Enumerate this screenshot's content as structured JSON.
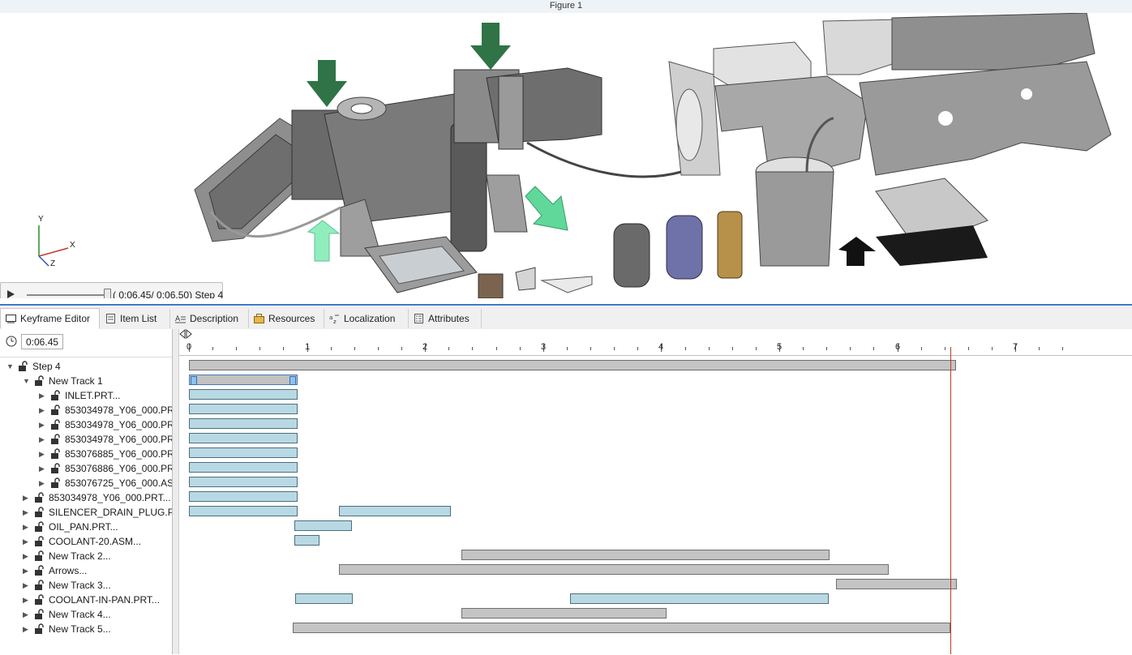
{
  "window": {
    "title": "Figure 1"
  },
  "axis_triad": {
    "y": "Y",
    "x": "X",
    "z": "Z"
  },
  "player": {
    "readout": "( 0:06.45/ 0:06.50)",
    "step": "Step 4",
    "progress": 0.992
  },
  "tabs": [
    {
      "label": "Keyframe Editor",
      "icon": "keyframe-editor-icon",
      "active": true
    },
    {
      "label": "Item List",
      "icon": "item-list-icon",
      "active": false
    },
    {
      "label": "Description",
      "icon": "description-icon",
      "active": false
    },
    {
      "label": "Resources",
      "icon": "resources-icon",
      "active": false
    },
    {
      "label": "Localization",
      "icon": "localization-icon",
      "active": false
    },
    {
      "label": "Attributes",
      "icon": "attributes-icon",
      "active": false
    }
  ],
  "time_field": {
    "value": "0:06.45"
  },
  "tree": [
    {
      "label": "Step 4",
      "level": 0,
      "expanded": true
    },
    {
      "label": "New Track 1",
      "level": 1,
      "expanded": true
    },
    {
      "label": "INLET.PRT...",
      "level": 2,
      "expanded": false
    },
    {
      "label": "853034978_Y06_000.PRT...",
      "level": 2,
      "expanded": false
    },
    {
      "label": "853034978_Y06_000.PRT...",
      "level": 2,
      "expanded": false
    },
    {
      "label": "853034978_Y06_000.PRT...",
      "level": 2,
      "expanded": false
    },
    {
      "label": "853076885_Y06_000.PRT...",
      "level": 2,
      "expanded": false
    },
    {
      "label": "853076886_Y06_000.PRT...",
      "level": 2,
      "expanded": false
    },
    {
      "label": "853076725_Y06_000.ASM...",
      "level": 2,
      "expanded": false
    },
    {
      "label": "853034978_Y06_000.PRT...",
      "level": 1,
      "expanded": false
    },
    {
      "label": "SILENCER_DRAIN_PLUG.PRT...",
      "level": 1,
      "expanded": false
    },
    {
      "label": "OIL_PAN.PRT...",
      "level": 1,
      "expanded": false
    },
    {
      "label": "COOLANT-20.ASM...",
      "level": 1,
      "expanded": false
    },
    {
      "label": "New Track 2...",
      "level": 1,
      "expanded": false
    },
    {
      "label": "Arrows...",
      "level": 1,
      "expanded": false
    },
    {
      "label": "New Track 3...",
      "level": 1,
      "expanded": false
    },
    {
      "label": "COOLANT-IN-PAN.PRT...",
      "level": 1,
      "expanded": false
    },
    {
      "label": "New Track 4...",
      "level": 1,
      "expanded": false
    },
    {
      "label": "New Track 5...",
      "level": 1,
      "expanded": false
    }
  ],
  "timeline": {
    "tick_labels": [
      "0",
      "1",
      "2",
      "3",
      "4",
      "5",
      "6",
      "7"
    ],
    "current_time": 6.45,
    "rows": [
      [
        {
          "start": 0.0,
          "end": 6.5,
          "color": "gray"
        }
      ],
      [
        {
          "start": 0.0,
          "end": 0.92,
          "color": "gray",
          "selected": true
        }
      ],
      [
        {
          "start": 0.0,
          "end": 0.92,
          "color": "blue"
        }
      ],
      [
        {
          "start": 0.0,
          "end": 0.92,
          "color": "blue"
        }
      ],
      [
        {
          "start": 0.0,
          "end": 0.92,
          "color": "blue"
        }
      ],
      [
        {
          "start": 0.0,
          "end": 0.92,
          "color": "blue"
        }
      ],
      [
        {
          "start": 0.0,
          "end": 0.92,
          "color": "blue"
        }
      ],
      [
        {
          "start": 0.0,
          "end": 0.92,
          "color": "blue"
        }
      ],
      [
        {
          "start": 0.0,
          "end": 0.92,
          "color": "blue"
        }
      ],
      [
        {
          "start": 0.0,
          "end": 0.92,
          "color": "blue"
        }
      ],
      [
        {
          "start": 0.0,
          "end": 0.92,
          "color": "blue"
        },
        {
          "start": 1.27,
          "end": 2.22,
          "color": "blue"
        }
      ],
      [
        {
          "start": 0.89,
          "end": 1.38,
          "color": "blue"
        }
      ],
      [
        {
          "start": 0.89,
          "end": 1.1,
          "color": "blue"
        }
      ],
      [
        {
          "start": 2.31,
          "end": 5.43,
          "color": "gray"
        }
      ],
      [
        {
          "start": 1.27,
          "end": 5.93,
          "color": "gray"
        }
      ],
      [
        {
          "start": 5.48,
          "end": 6.5,
          "color": "gray"
        }
      ],
      [
        {
          "start": 0.9,
          "end": 1.39,
          "color": "blue"
        },
        {
          "start": 3.23,
          "end": 5.42,
          "color": "blue"
        }
      ],
      [
        {
          "start": 2.31,
          "end": 4.05,
          "color": "gray"
        }
      ],
      [
        {
          "start": 0.88,
          "end": 6.45,
          "color": "gray"
        }
      ]
    ]
  },
  "colors": {
    "accent": "#3e78c8",
    "bar_blue": "#b8d9e3",
    "bar_gray": "#c4c4c4",
    "cursor": "#c0392b",
    "arrow_green_dark": "#2f7346",
    "arrow_green_light": "#7fe6b0"
  }
}
